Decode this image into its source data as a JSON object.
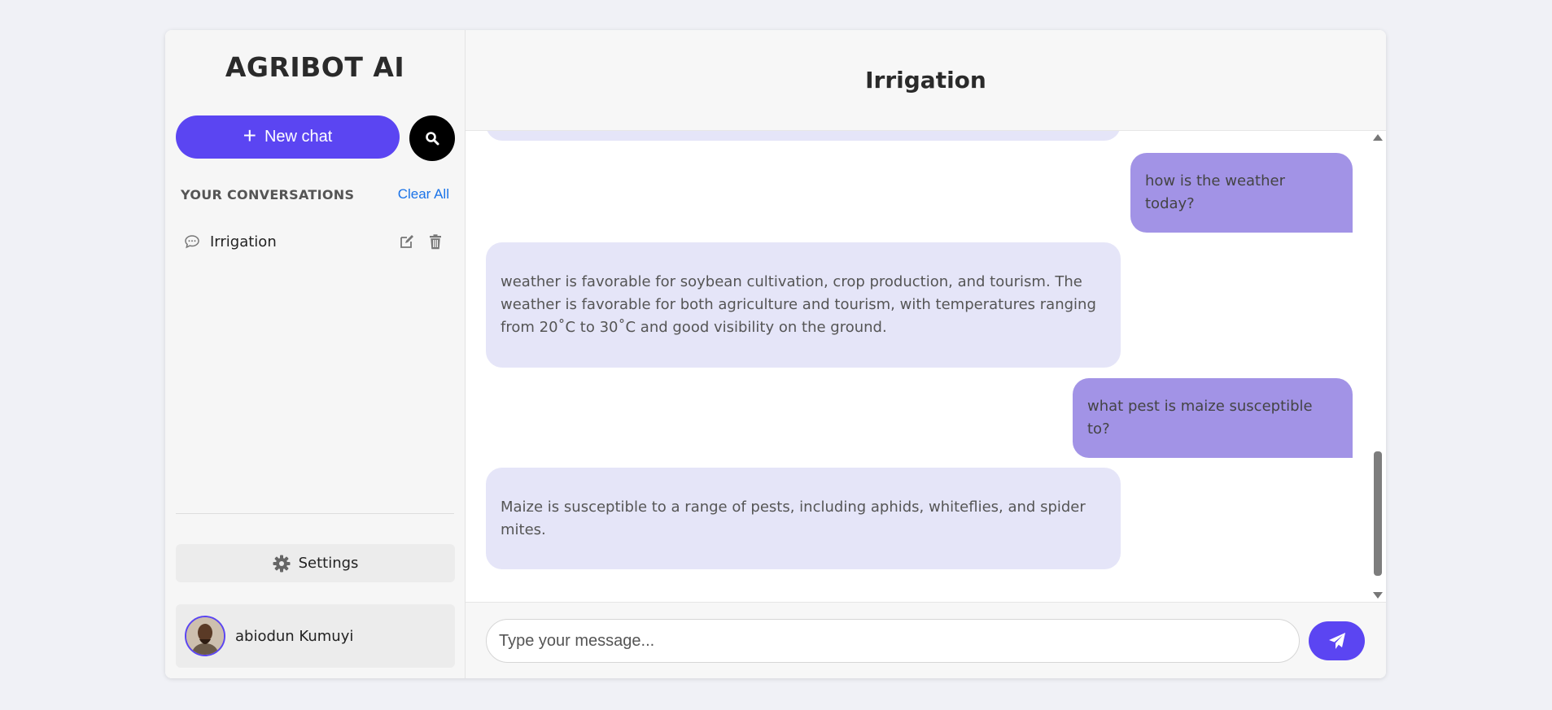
{
  "sidebar": {
    "brand": "AGRIBOT AI",
    "new_chat_label": "New chat",
    "conversations_heading": "YOUR CONVERSATIONS",
    "clear_all_label": "Clear All",
    "conversations": [
      {
        "label": "Irrigation"
      }
    ],
    "settings_label": "Settings",
    "user_name": "abiodun Kumuyi"
  },
  "chat": {
    "title": "Irrigation",
    "messages": [
      {
        "role": "user",
        "text": "how is the weather today?"
      },
      {
        "role": "bot",
        "text": "weather is favorable for soybean cultivation, crop production, and tourism. The weather is favorable for both agriculture and tourism, with temperatures ranging from 20˚C to 30˚C and good visibility on the ground."
      },
      {
        "role": "user",
        "text": "what pest is maize susceptible to?"
      },
      {
        "role": "bot",
        "text": "Maize is susceptible to a range of pests, including aphids, whiteflies, and spider mites."
      }
    ]
  },
  "composer": {
    "placeholder": "Type your message..."
  },
  "colors": {
    "accent": "#5b45f2",
    "user_bubble": "#a293e6",
    "bot_bubble": "#e5e5f8",
    "link": "#1a73e8"
  }
}
